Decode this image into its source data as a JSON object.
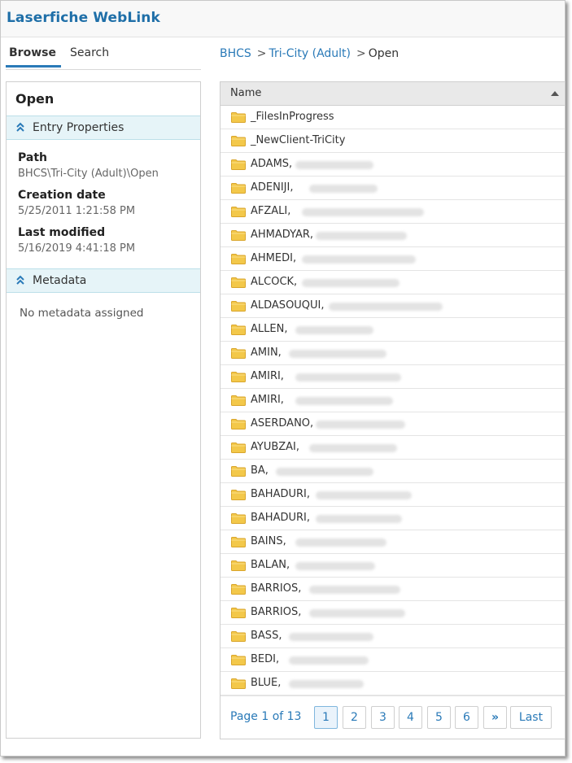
{
  "app": {
    "brand": "Laserfiche WebLink"
  },
  "nav": {
    "tabs": [
      {
        "label": "Browse",
        "active": true
      },
      {
        "label": "Search",
        "active": false
      }
    ]
  },
  "breadcrumb": {
    "items": [
      "BHCS",
      "Tri-City (Adult)",
      "Open"
    ],
    "separator": ">"
  },
  "left_panel": {
    "title": "Open",
    "entry_properties": {
      "heading": "Entry Properties",
      "path_label": "Path",
      "path_value": "BHCS\\Tri-City (Adult)\\Open",
      "created_label": "Creation date",
      "created_value": "5/25/2011 1:21:58 PM",
      "modified_label": "Last modified",
      "modified_value": "5/16/2019 4:41:18 PM"
    },
    "metadata": {
      "heading": "Metadata",
      "empty_text": "No metadata assigned"
    }
  },
  "list": {
    "column_header": "Name",
    "sort": "ascending",
    "rows": [
      "_FilesInProgress",
      "_NewClient-TriCity",
      "ADAMS,",
      "ADENIJI,",
      "AFZALI,",
      "AHMADYAR,",
      "AHMEDI,",
      "ALCOCK,",
      "ALDASOUQUI,",
      "ALLEN,",
      "AMIN,",
      "AMIRI,",
      "AMIRI,",
      "ASERDANO,",
      "AYUBZAI,",
      "BA,",
      "BAHADURI,",
      "BAHADURI,",
      "BAINS,",
      "BALAN,",
      "BARRIOS,",
      "BARRIOS,",
      "BASS,",
      "BEDI,",
      "BLUE,"
    ]
  },
  "pager": {
    "info": "Page 1 of 13",
    "pages": [
      "1",
      "2",
      "3",
      "4",
      "5",
      "6"
    ],
    "current": "1",
    "next_label": "»",
    "last_label": "Last"
  },
  "colors": {
    "brand": "#1f6fa8",
    "link": "#2a7ab8",
    "section_bg": "#e6f4f8",
    "folder": "#f3c84a"
  }
}
